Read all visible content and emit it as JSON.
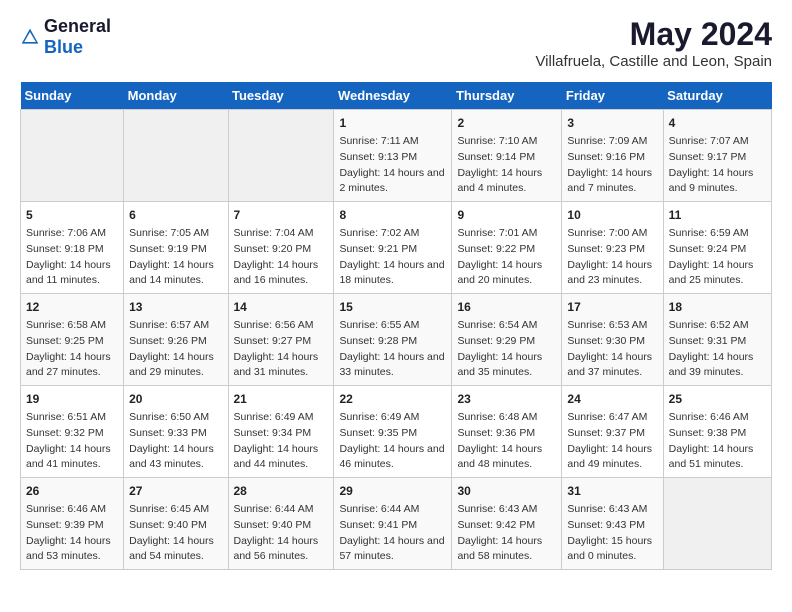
{
  "header": {
    "logo_general": "General",
    "logo_blue": "Blue",
    "title": "May 2024",
    "subtitle": "Villafruela, Castille and Leon, Spain"
  },
  "days_of_week": [
    "Sunday",
    "Monday",
    "Tuesday",
    "Wednesday",
    "Thursday",
    "Friday",
    "Saturday"
  ],
  "weeks": [
    [
      {
        "day": "",
        "sunrise": "",
        "sunset": "",
        "daylight": ""
      },
      {
        "day": "",
        "sunrise": "",
        "sunset": "",
        "daylight": ""
      },
      {
        "day": "",
        "sunrise": "",
        "sunset": "",
        "daylight": ""
      },
      {
        "day": "1",
        "sunrise": "Sunrise: 7:11 AM",
        "sunset": "Sunset: 9:13 PM",
        "daylight": "Daylight: 14 hours and 2 minutes."
      },
      {
        "day": "2",
        "sunrise": "Sunrise: 7:10 AM",
        "sunset": "Sunset: 9:14 PM",
        "daylight": "Daylight: 14 hours and 4 minutes."
      },
      {
        "day": "3",
        "sunrise": "Sunrise: 7:09 AM",
        "sunset": "Sunset: 9:16 PM",
        "daylight": "Daylight: 14 hours and 7 minutes."
      },
      {
        "day": "4",
        "sunrise": "Sunrise: 7:07 AM",
        "sunset": "Sunset: 9:17 PM",
        "daylight": "Daylight: 14 hours and 9 minutes."
      }
    ],
    [
      {
        "day": "5",
        "sunrise": "Sunrise: 7:06 AM",
        "sunset": "Sunset: 9:18 PM",
        "daylight": "Daylight: 14 hours and 11 minutes."
      },
      {
        "day": "6",
        "sunrise": "Sunrise: 7:05 AM",
        "sunset": "Sunset: 9:19 PM",
        "daylight": "Daylight: 14 hours and 14 minutes."
      },
      {
        "day": "7",
        "sunrise": "Sunrise: 7:04 AM",
        "sunset": "Sunset: 9:20 PM",
        "daylight": "Daylight: 14 hours and 16 minutes."
      },
      {
        "day": "8",
        "sunrise": "Sunrise: 7:02 AM",
        "sunset": "Sunset: 9:21 PM",
        "daylight": "Daylight: 14 hours and 18 minutes."
      },
      {
        "day": "9",
        "sunrise": "Sunrise: 7:01 AM",
        "sunset": "Sunset: 9:22 PM",
        "daylight": "Daylight: 14 hours and 20 minutes."
      },
      {
        "day": "10",
        "sunrise": "Sunrise: 7:00 AM",
        "sunset": "Sunset: 9:23 PM",
        "daylight": "Daylight: 14 hours and 23 minutes."
      },
      {
        "day": "11",
        "sunrise": "Sunrise: 6:59 AM",
        "sunset": "Sunset: 9:24 PM",
        "daylight": "Daylight: 14 hours and 25 minutes."
      }
    ],
    [
      {
        "day": "12",
        "sunrise": "Sunrise: 6:58 AM",
        "sunset": "Sunset: 9:25 PM",
        "daylight": "Daylight: 14 hours and 27 minutes."
      },
      {
        "day": "13",
        "sunrise": "Sunrise: 6:57 AM",
        "sunset": "Sunset: 9:26 PM",
        "daylight": "Daylight: 14 hours and 29 minutes."
      },
      {
        "day": "14",
        "sunrise": "Sunrise: 6:56 AM",
        "sunset": "Sunset: 9:27 PM",
        "daylight": "Daylight: 14 hours and 31 minutes."
      },
      {
        "day": "15",
        "sunrise": "Sunrise: 6:55 AM",
        "sunset": "Sunset: 9:28 PM",
        "daylight": "Daylight: 14 hours and 33 minutes."
      },
      {
        "day": "16",
        "sunrise": "Sunrise: 6:54 AM",
        "sunset": "Sunset: 9:29 PM",
        "daylight": "Daylight: 14 hours and 35 minutes."
      },
      {
        "day": "17",
        "sunrise": "Sunrise: 6:53 AM",
        "sunset": "Sunset: 9:30 PM",
        "daylight": "Daylight: 14 hours and 37 minutes."
      },
      {
        "day": "18",
        "sunrise": "Sunrise: 6:52 AM",
        "sunset": "Sunset: 9:31 PM",
        "daylight": "Daylight: 14 hours and 39 minutes."
      }
    ],
    [
      {
        "day": "19",
        "sunrise": "Sunrise: 6:51 AM",
        "sunset": "Sunset: 9:32 PM",
        "daylight": "Daylight: 14 hours and 41 minutes."
      },
      {
        "day": "20",
        "sunrise": "Sunrise: 6:50 AM",
        "sunset": "Sunset: 9:33 PM",
        "daylight": "Daylight: 14 hours and 43 minutes."
      },
      {
        "day": "21",
        "sunrise": "Sunrise: 6:49 AM",
        "sunset": "Sunset: 9:34 PM",
        "daylight": "Daylight: 14 hours and 44 minutes."
      },
      {
        "day": "22",
        "sunrise": "Sunrise: 6:49 AM",
        "sunset": "Sunset: 9:35 PM",
        "daylight": "Daylight: 14 hours and 46 minutes."
      },
      {
        "day": "23",
        "sunrise": "Sunrise: 6:48 AM",
        "sunset": "Sunset: 9:36 PM",
        "daylight": "Daylight: 14 hours and 48 minutes."
      },
      {
        "day": "24",
        "sunrise": "Sunrise: 6:47 AM",
        "sunset": "Sunset: 9:37 PM",
        "daylight": "Daylight: 14 hours and 49 minutes."
      },
      {
        "day": "25",
        "sunrise": "Sunrise: 6:46 AM",
        "sunset": "Sunset: 9:38 PM",
        "daylight": "Daylight: 14 hours and 51 minutes."
      }
    ],
    [
      {
        "day": "26",
        "sunrise": "Sunrise: 6:46 AM",
        "sunset": "Sunset: 9:39 PM",
        "daylight": "Daylight: 14 hours and 53 minutes."
      },
      {
        "day": "27",
        "sunrise": "Sunrise: 6:45 AM",
        "sunset": "Sunset: 9:40 PM",
        "daylight": "Daylight: 14 hours and 54 minutes."
      },
      {
        "day": "28",
        "sunrise": "Sunrise: 6:44 AM",
        "sunset": "Sunset: 9:40 PM",
        "daylight": "Daylight: 14 hours and 56 minutes."
      },
      {
        "day": "29",
        "sunrise": "Sunrise: 6:44 AM",
        "sunset": "Sunset: 9:41 PM",
        "daylight": "Daylight: 14 hours and 57 minutes."
      },
      {
        "day": "30",
        "sunrise": "Sunrise: 6:43 AM",
        "sunset": "Sunset: 9:42 PM",
        "daylight": "Daylight: 14 hours and 58 minutes."
      },
      {
        "day": "31",
        "sunrise": "Sunrise: 6:43 AM",
        "sunset": "Sunset: 9:43 PM",
        "daylight": "Daylight: 15 hours and 0 minutes."
      },
      {
        "day": "",
        "sunrise": "",
        "sunset": "",
        "daylight": ""
      }
    ]
  ]
}
